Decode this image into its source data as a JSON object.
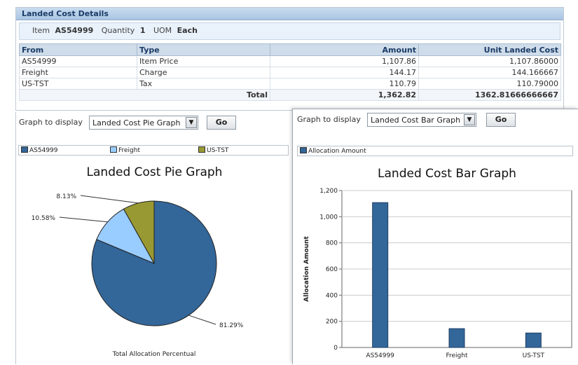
{
  "details": {
    "title": "Landed Cost Details",
    "item_label": "Item",
    "item_value": "AS54999",
    "quantity_label": "Quantity",
    "quantity_value": "1",
    "uom_label": "UOM",
    "uom_value": "Each",
    "columns": [
      "From",
      "Type",
      "Amount",
      "Unit Landed Cost"
    ],
    "rows": [
      {
        "from": "AS54999",
        "type": "Item Price",
        "amount": "1,107.86",
        "unit": "1,107.86000"
      },
      {
        "from": "Freight",
        "type": "Charge",
        "amount": "144.17",
        "unit": "144.166667"
      },
      {
        "from": "US-TST",
        "type": "Tax",
        "amount": "110.79",
        "unit": "110.79000"
      }
    ],
    "total_label": "Total",
    "total_amount": "1,362.82",
    "total_unit": "1362.81666666667"
  },
  "left_graph": {
    "display_label": "Graph to display",
    "selected": "Landed Cost Pie Graph",
    "go_label": "Go",
    "legend": [
      {
        "name": "AS54999",
        "color": "#336699"
      },
      {
        "name": "Freight",
        "color": "#99ccff"
      },
      {
        "name": "US-TST",
        "color": "#999933"
      }
    ]
  },
  "right_graph": {
    "display_label": "Graph to display",
    "selected": "Landed Cost Bar Graph",
    "go_label": "Go",
    "legend": [
      {
        "name": "Allocation Amount",
        "color": "#336699"
      }
    ]
  },
  "chart_data": [
    {
      "type": "pie",
      "title": "Landed Cost Pie Graph",
      "xlabel": "Total Allocation Percentual",
      "categories": [
        "AS54999",
        "Freight",
        "US-TST"
      ],
      "values": [
        81.29,
        10.58,
        8.13
      ],
      "labels": [
        "81.29%",
        "10.58%",
        "8.13%"
      ],
      "colors": [
        "#336699",
        "#99ccff",
        "#999933"
      ],
      "legend_position": "top"
    },
    {
      "type": "bar",
      "title": "Landed Cost Bar Graph",
      "categories": [
        "AS54999",
        "Freight",
        "US-TST"
      ],
      "series": [
        {
          "name": "Allocation Amount",
          "values": [
            1107.86,
            144.17,
            110.79
          ]
        }
      ],
      "ylabel": "Allocation Amount",
      "ylim": [
        0,
        1200
      ],
      "yticks": [
        0,
        200,
        400,
        600,
        800,
        1000,
        1200
      ],
      "ytick_labels": [
        "0",
        "200",
        "400",
        "600",
        "800",
        "1,000",
        "1,200"
      ],
      "grid": true,
      "color": "#336699",
      "legend_position": "top"
    }
  ]
}
